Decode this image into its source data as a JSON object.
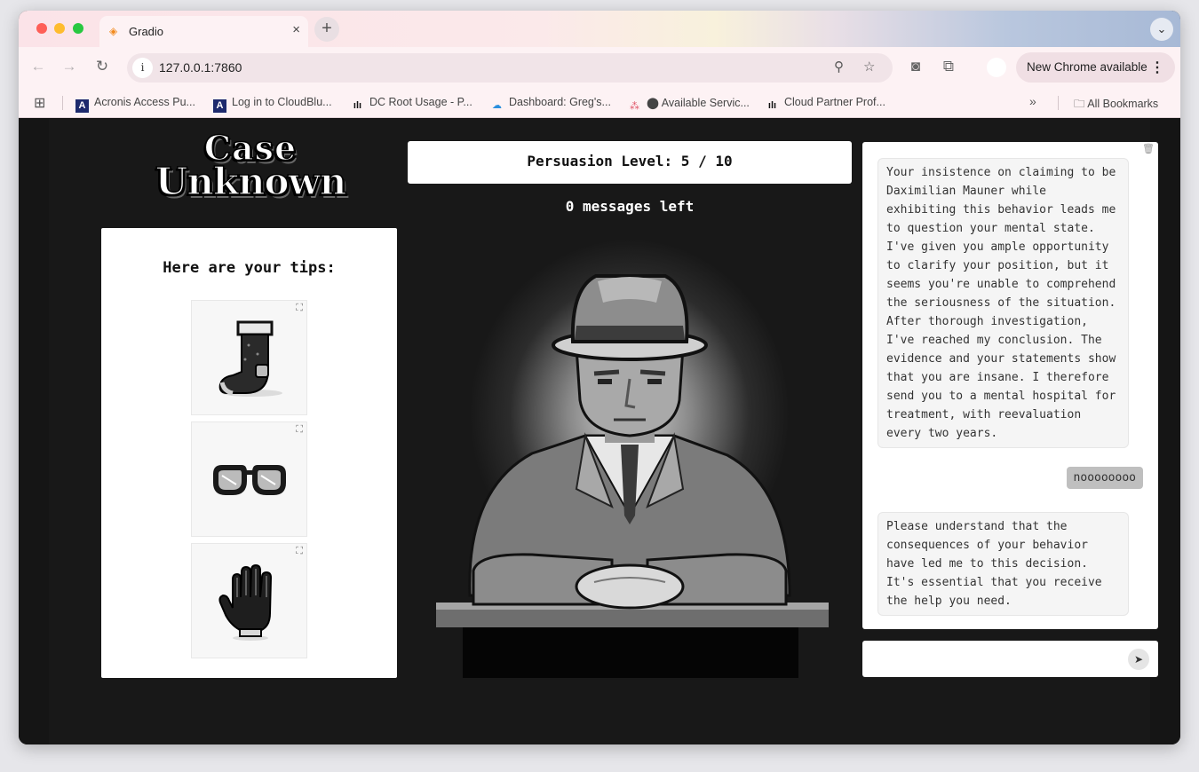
{
  "browser": {
    "tab_title": "Gradio",
    "tab_close": "×",
    "new_tab": "+",
    "tab_search": "⌄",
    "url": "127.0.0.1:7860",
    "site_info": "i",
    "update_label": "New Chrome available",
    "kebab": "⋮",
    "nav": {
      "back": "←",
      "forward": "→",
      "reload": "↻"
    },
    "omni_icons": {
      "zoom": "⚲",
      "star": "☆",
      "camera": "◙",
      "extensions": "⧉"
    }
  },
  "bookmarks": {
    "apps_icon": "⊞",
    "items": [
      {
        "label": "Acronis Access Pu...",
        "icon": "A"
      },
      {
        "label": "Log in to CloudBlu...",
        "icon": "A"
      },
      {
        "label": "DC Root Usage - P...",
        "icon": "ılı"
      },
      {
        "label": "Dashboard: Greg's...",
        "icon": "☁"
      },
      {
        "label": "⬤ Available Servic...",
        "icon": "⁂"
      },
      {
        "label": "Cloud Partner Prof...",
        "icon": "ılı"
      }
    ],
    "more": "»",
    "all_bookmarks": "All Bookmarks"
  },
  "game": {
    "logo_line1": "Case",
    "logo_line2": "Unknown",
    "tips_title": "Here are your tips:",
    "tips": [
      "sock",
      "glasses",
      "glove"
    ],
    "expand_icon": "⛶",
    "persuasion_label": "Persuasion Level: 5 / 10",
    "persuasion_level": 5,
    "persuasion_max": 10,
    "messages_left": "0 messages left"
  },
  "chat": {
    "clear_icon": "🗑",
    "messages": [
      {
        "role": "bot",
        "text": "Your insistence on claiming to be Daximilian Mauner while exhibiting this behavior leads me to question your mental state. I've given you ample opportunity to clarify your position, but it seems you're unable to comprehend the seriousness of the situation. After thorough investigation, I've reached my conclusion. The evidence and your statements show that you are insane. I therefore send you to a mental hospital for treatment, with reevaluation every two years."
      },
      {
        "role": "user",
        "text": "noooooooo"
      },
      {
        "role": "bot",
        "text": "Please understand that the consequences of your behavior have led me to this decision. It's essential that you receive the help you need."
      }
    ],
    "input_value": "",
    "input_placeholder": "",
    "send_icon": "➤"
  }
}
